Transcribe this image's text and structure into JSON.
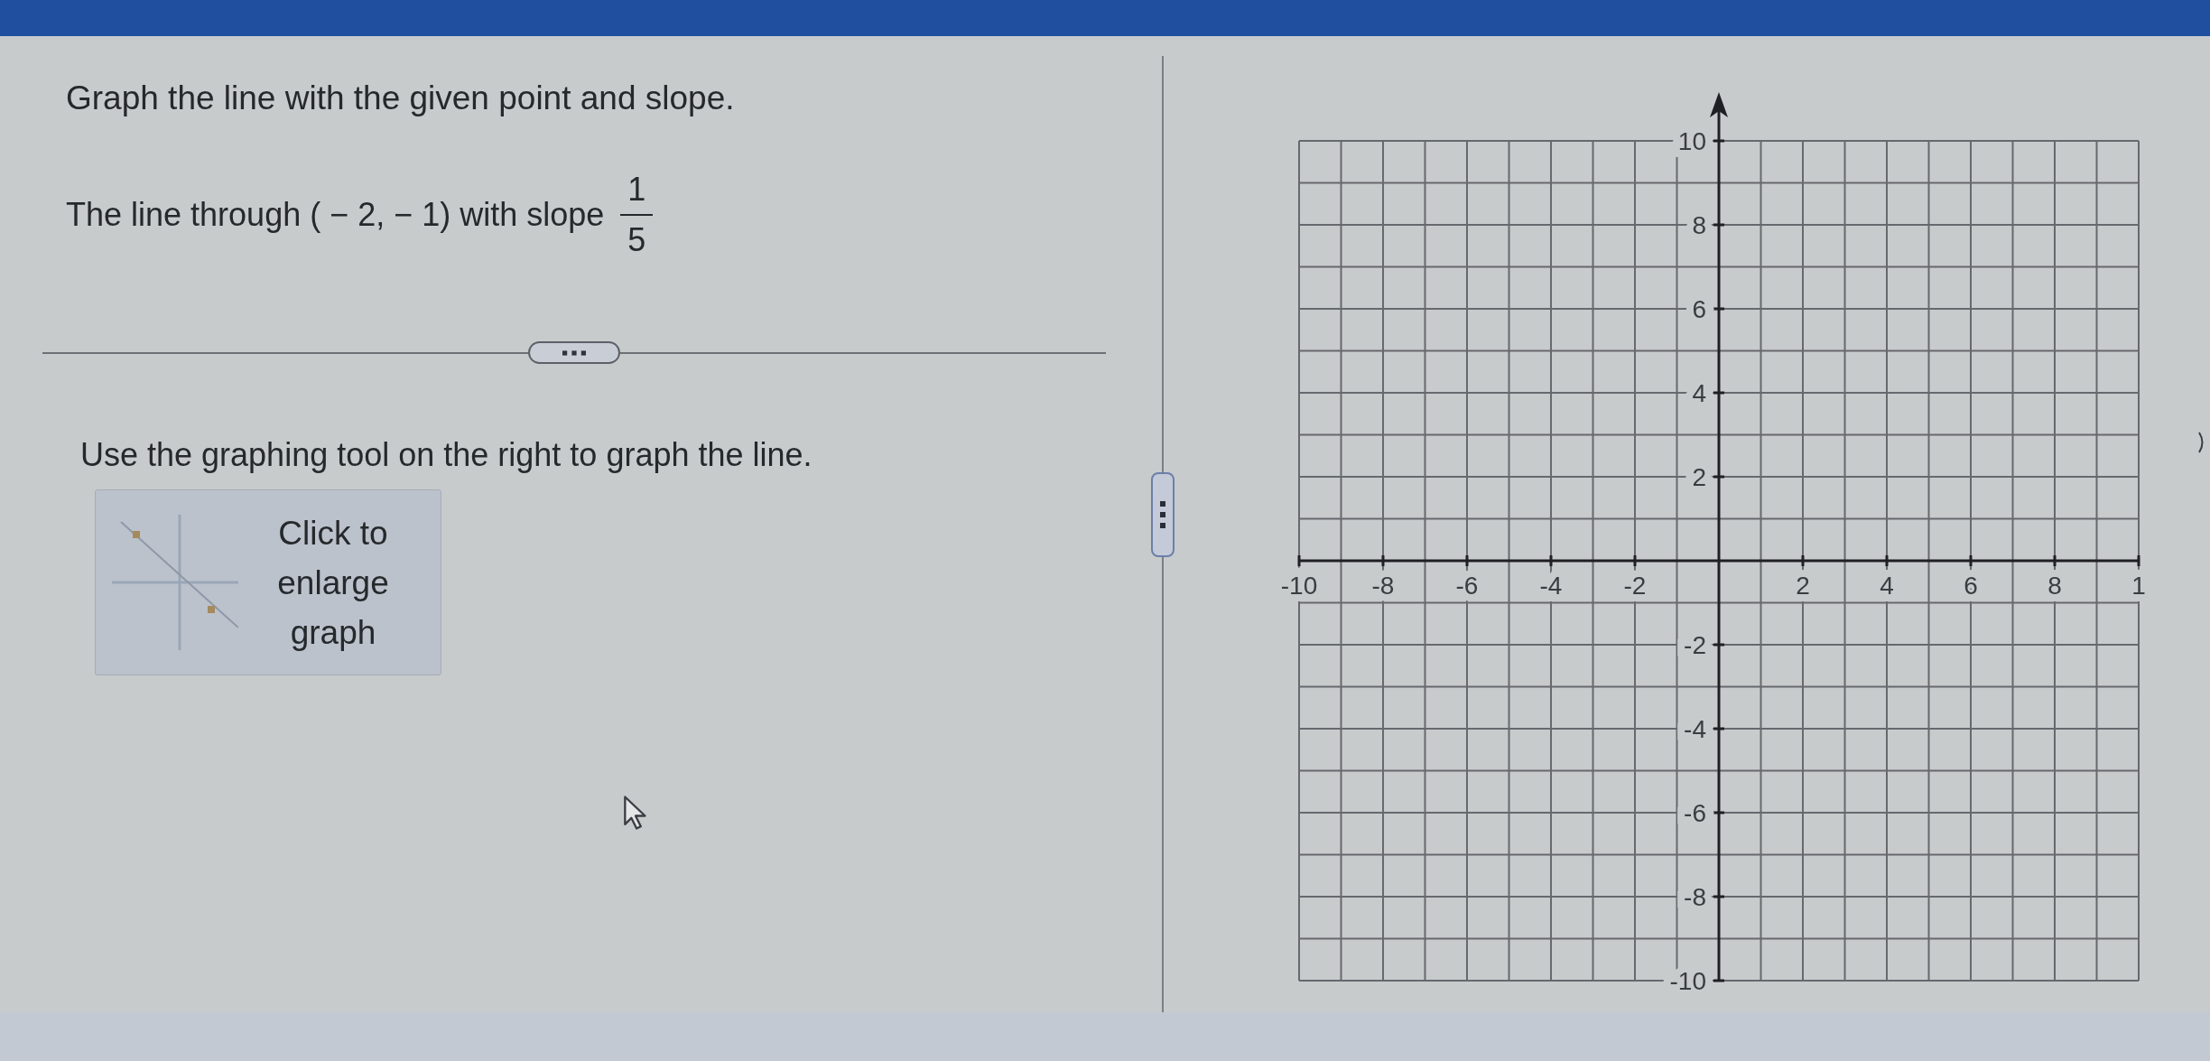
{
  "problem": {
    "title": "Graph the line with the given point and slope.",
    "question": "The line through ( − 2, − 1) with slope",
    "slope": {
      "numerator": "1",
      "denominator": "5"
    },
    "instruction": "Use the graphing tool on the right to graph the line.",
    "enlarge_button": "Click to enlarge graph"
  },
  "graph": {
    "x_labels": [
      "-10",
      "-8",
      "-6",
      "-4",
      "-2",
      "2",
      "4",
      "6",
      "8",
      "1"
    ],
    "y_labels": [
      "10",
      "8",
      "6",
      "4",
      "2",
      "-2",
      "-4",
      "-6",
      "-8",
      "-10"
    ]
  }
}
